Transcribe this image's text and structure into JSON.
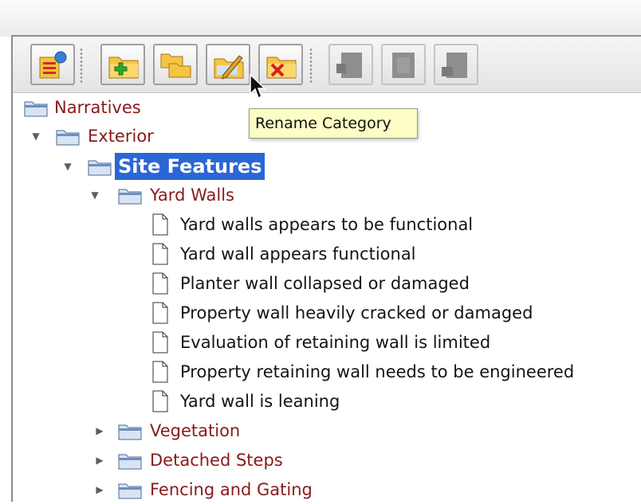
{
  "toolbar": {
    "buttons": [
      {
        "name": "narrative-list-button",
        "icon": "list-folder-icon",
        "enabled": true
      },
      {
        "name": "add-category-button",
        "icon": "folder-add-icon",
        "enabled": true
      },
      {
        "name": "move-category-button",
        "icon": "folders-icon",
        "enabled": true
      },
      {
        "name": "rename-category-button",
        "icon": "folder-edit-icon",
        "enabled": true
      },
      {
        "name": "delete-category-button",
        "icon": "folder-delete-icon",
        "enabled": true
      },
      {
        "name": "add-narrative-button",
        "icon": "document-add-icon",
        "enabled": false
      },
      {
        "name": "edit-narrative-button",
        "icon": "document-edit-icon",
        "enabled": false
      },
      {
        "name": "delete-narrative-button",
        "icon": "document-delete-icon",
        "enabled": false
      }
    ]
  },
  "tooltip": {
    "text": "Rename Category"
  },
  "tree": {
    "root": "Narratives",
    "exterior": "Exterior",
    "site_features": "Site Features",
    "yard_walls": "Yard Walls",
    "items": [
      "Yard walls appears to be functional",
      "Yard wall appears functional",
      "Planter wall collapsed or damaged",
      "Property wall heavily cracked or damaged",
      "Evaluation of retaining wall is limited",
      "Property retaining wall needs to be engineered",
      "Yard wall is leaning"
    ],
    "collapsed": [
      "Vegetation",
      "Detached Steps",
      "Fencing and Gating"
    ]
  },
  "colors": {
    "category_text": "#8a1a1a",
    "selection": "#2a66d6",
    "tooltip_bg": "#fdfdc6"
  }
}
